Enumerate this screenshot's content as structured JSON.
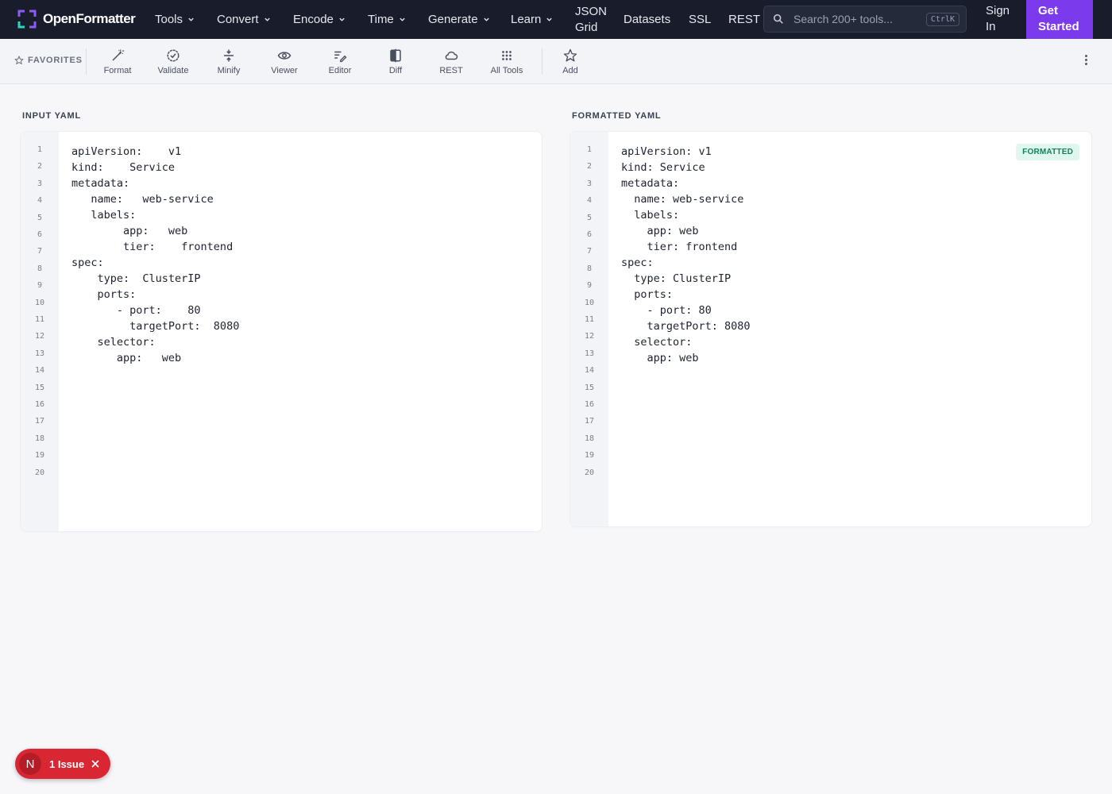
{
  "brand": {
    "name": "OpenFormatter",
    "accent": "#7c3aed"
  },
  "nav": {
    "items": [
      {
        "label": "Tools",
        "dropdown": true
      },
      {
        "label": "Convert",
        "dropdown": true
      },
      {
        "label": "Encode",
        "dropdown": true
      },
      {
        "label": "Time",
        "dropdown": true
      },
      {
        "label": "Generate",
        "dropdown": true
      },
      {
        "label": "Learn",
        "dropdown": true
      }
    ],
    "json_grid": [
      "JSON",
      "Grid"
    ],
    "datasets": "Datasets",
    "ssl": "SSL",
    "rest": "REST",
    "search_placeholder": "Search 200+ tools...",
    "search_shortcut": "CtrlK",
    "sign_in": [
      "Sign",
      "In"
    ],
    "get_started": [
      "Get",
      "Started"
    ]
  },
  "toolbar": {
    "favorites_label": "FAVORITES",
    "tools": [
      {
        "label": "Format",
        "icon": "magic-wand-icon"
      },
      {
        "label": "Validate",
        "icon": "check-badge-icon"
      },
      {
        "label": "Minify",
        "icon": "compress-icon"
      },
      {
        "label": "Viewer",
        "icon": "eye-icon"
      },
      {
        "label": "Editor",
        "icon": "edit-lines-icon"
      },
      {
        "label": "Diff",
        "icon": "diff-icon"
      },
      {
        "label": "REST",
        "icon": "cloud-icon"
      },
      {
        "label": "All Tools",
        "icon": "grid-dots-icon"
      }
    ],
    "add_label": "Add"
  },
  "input": {
    "label": "INPUT YAML",
    "line_numbers": [
      "1",
      "2",
      "3",
      "4",
      "5",
      "6",
      "7",
      "8",
      "9",
      "10",
      "11",
      "12",
      "13",
      "14",
      "15",
      "16",
      "17",
      "18",
      "19",
      "20"
    ],
    "code": "apiVersion:    v1\nkind:    Service\nmetadata:\n   name:   web-service\n   labels:\n        app:   web\n        tier:    frontend\nspec:\n    type:  ClusterIP\n    ports:\n       - port:    80\n         targetPort:  8080\n    selector:\n       app:   web"
  },
  "output": {
    "label": "FORMATTED YAML",
    "badge": "FORMATTED",
    "line_numbers": [
      "1",
      "2",
      "3",
      "4",
      "5",
      "6",
      "7",
      "8",
      "9",
      "10",
      "11",
      "12",
      "13",
      "14",
      "15",
      "16",
      "17",
      "18",
      "19",
      "20"
    ],
    "code": "apiVersion: v1\nkind: Service\nmetadata:\n  name: web-service\n  labels:\n    app: web\n    tier: frontend\nspec:\n  type: ClusterIP\n  ports:\n    - port: 80\n    targetPort: 8080\n  selector:\n    app: web"
  },
  "issues": {
    "avatar": "N",
    "text": "1 Issue"
  }
}
